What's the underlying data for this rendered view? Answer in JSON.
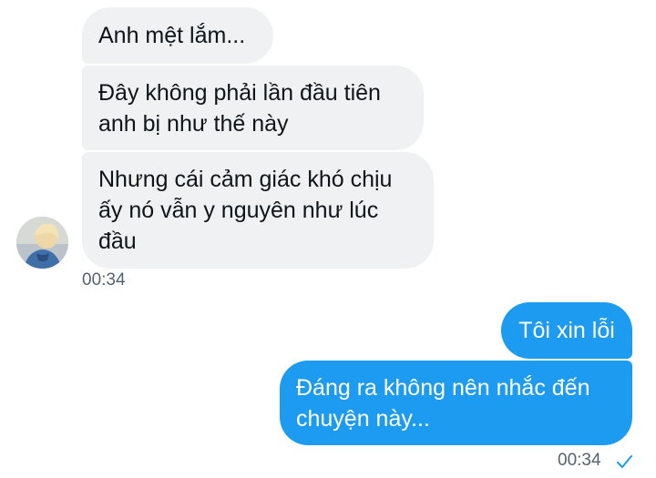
{
  "conversation": {
    "incoming": {
      "messages": [
        "Anh mệt lắm...",
        "Đây không phải lần đầu tiên\nanh bị như thế này",
        "Nhưng cái cảm giác khó chịu\nấy nó vẫn y nguyên như lúc\nđầu"
      ],
      "timestamp": "00:34",
      "avatar_icon": "user-avatar"
    },
    "outgoing": {
      "messages": [
        "Tôi xin lỗi",
        "Đáng ra không nên nhắc đến\nchuyện này..."
      ],
      "timestamp": "00:34",
      "status_icon": "check-icon"
    }
  },
  "colors": {
    "incoming_bubble": "#eff1f3",
    "outgoing_bubble": "#1d9bf0",
    "timestamp": "#536471",
    "check": "#1d9bf0"
  }
}
